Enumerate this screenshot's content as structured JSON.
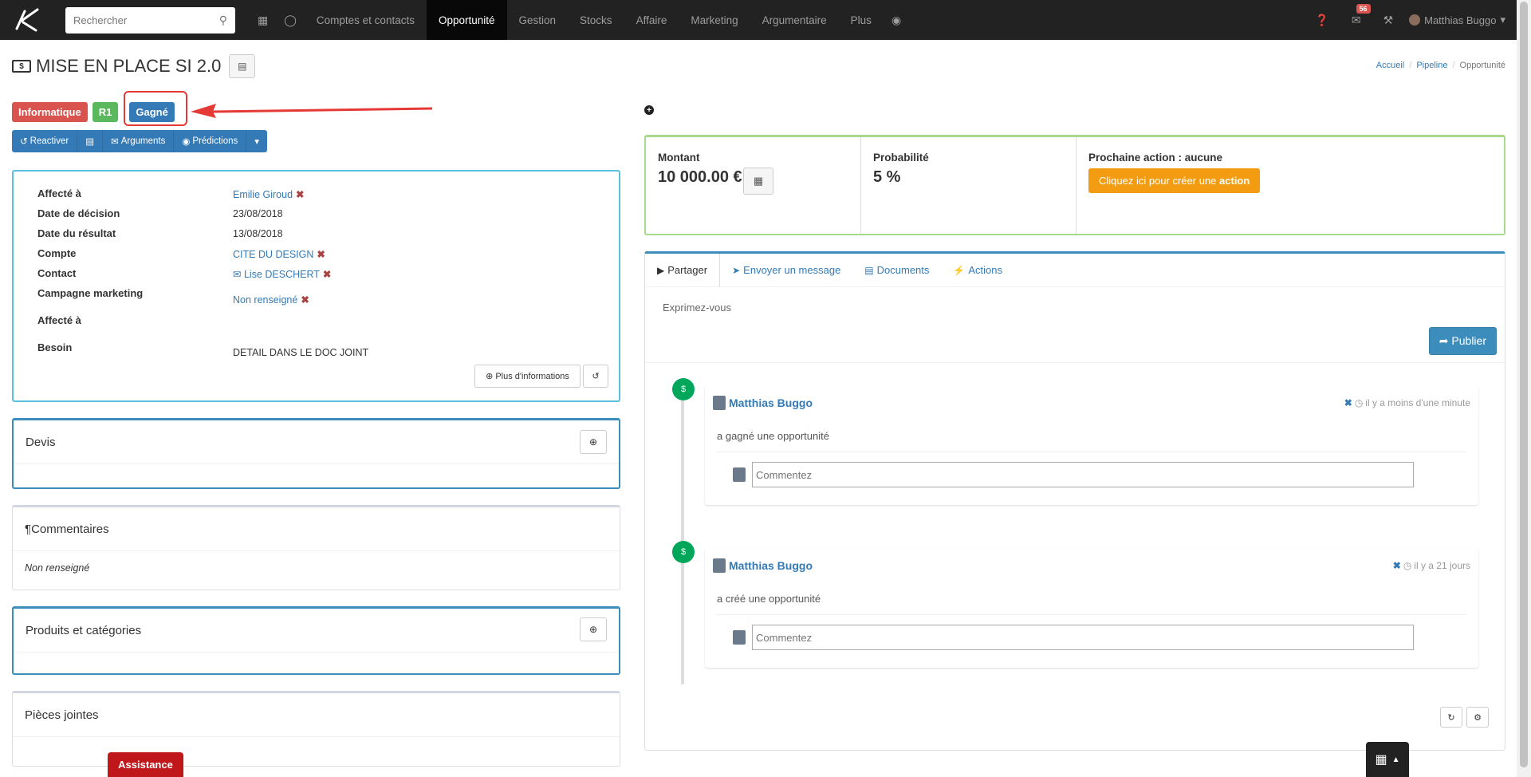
{
  "nav": {
    "search_placeholder": "Rechercher",
    "items": [
      "Comptes et contacts",
      "Opportunité",
      "Gestion",
      "Stocks",
      "Affaire",
      "Marketing",
      "Argumentaire",
      "Plus"
    ],
    "active": "Opportunité",
    "notif_count": "56",
    "user": "Matthias Buggo"
  },
  "title": "MISE EN PLACE SI 2.0",
  "breadcrumb": {
    "home": "Accueil",
    "pipeline": "Pipeline",
    "current": "Opportunité"
  },
  "labels": {
    "category": "Informatique",
    "stage": "R1",
    "status": "Gagné"
  },
  "buttons": {
    "reactivate": "Reactiver",
    "arguments": "Arguments",
    "predictions": "Prédictions"
  },
  "info": {
    "assigned_key": "Affecté à",
    "assigned_val": "Emilie Giroud",
    "decision_key": "Date de décision",
    "decision_val": "23/08/2018",
    "result_key": "Date du résultat",
    "result_val": "13/08/2018",
    "account_key": "Compte",
    "account_val": "CITE DU DESIGN",
    "contact_key": "Contact",
    "contact_val": "Lise DESCHERT",
    "campaign_key": "Campagne marketing",
    "campaign_val": "Non renseigné",
    "assigned2_key": "Affecté à",
    "need_key": "Besoin",
    "need_val": "DETAIL DANS LE DOC JOINT",
    "more_info": "Plus d'informations"
  },
  "boxes": {
    "quotes": "Devis",
    "comments": "Commentaires",
    "comments_empty": "Non renseigné",
    "products": "Produits et catégories",
    "attachments": "Pièces jointes"
  },
  "assist": "Assistance",
  "stats": {
    "amount_label": "Montant",
    "amount_val": "10 000.00 €",
    "prob_label": "Probabilité",
    "prob_val": "5 %",
    "next_label": "Prochaine action : aucune",
    "create_action_pre": "Cliquez ici pour créer une ",
    "create_action_bold": "action"
  },
  "feed": {
    "tabs": [
      "Partager",
      "Envoyer un message",
      "Documents",
      "Actions"
    ],
    "share_placeholder": "Exprimez-vous",
    "publish": "Publier",
    "items": [
      {
        "author": "Matthias Buggo",
        "time": "il y a moins d'une minute",
        "text": "a gagné une opportunité",
        "comment_placeholder": "Commentez"
      },
      {
        "author": "Matthias Buggo",
        "time": "il y a 21 jours",
        "text": "a créé une opportunité",
        "comment_placeholder": "Commentez"
      }
    ]
  }
}
